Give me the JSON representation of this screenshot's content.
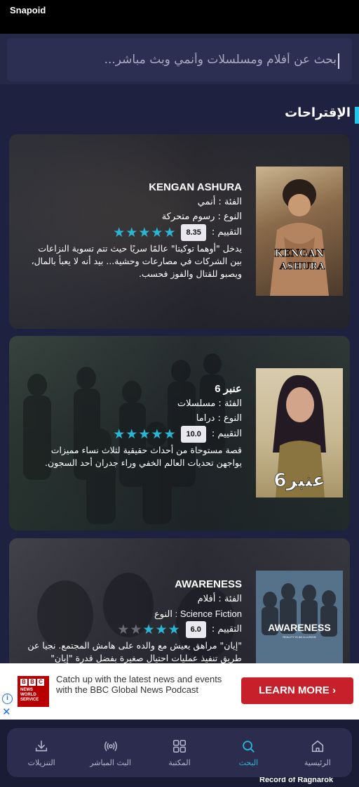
{
  "status_bar": {
    "app_name": "Snapoid"
  },
  "search": {
    "placeholder": "بحث عن أفلام ومسلسلات وأنمي وبث مباشر..."
  },
  "section": {
    "title": "الإقتراحات"
  },
  "cards": [
    {
      "title": "KENGAN ASHURA",
      "category": "الفئة : أنمي",
      "genre": "النوع : رسوم متحركة",
      "rating_label": "التقييم :",
      "rating_value": "8.35",
      "stars_filled": 5,
      "description": "يدخل \"أوهما توكيتا\" عالمًا سريًا حيث تتم تسوية النزاعات بين الشركات في مصارعات وحشية... بيد أنه لا يعبأ بالمال، ويصبو للقتال والفوز فحسب.",
      "poster_text": [
        "KENGAN",
        "ASHURA"
      ],
      "colors": {
        "bg": "#3a3a40",
        "poster": "#6a5a48"
      }
    },
    {
      "title": "عنبر 6",
      "category": "الفئة : مسلسلات",
      "genre": "النوع : دراما",
      "rating_label": "التقييم :",
      "rating_value": "10.0",
      "stars_filled": 5,
      "description": "قصة مستوحاة من أحداث حقيقية لثلاث نساء مميزات يواجهن تحديات العالم الخفي وراء جدران أحد السجون.",
      "poster_text": [
        "عنبر6"
      ],
      "colors": {
        "bg": "#2e3a34",
        "poster": "#c7b892"
      }
    },
    {
      "title": "AWARENESS",
      "category": "الفئة : أفلام",
      "genre": "Science Fiction : النوع",
      "rating_label": "التقييم :",
      "rating_value": "6.0",
      "stars_filled": 3,
      "description": "\"إيان\" مراهق يعيش مع والده على هامش المجتمع. نجيا عن طريق تنفيذ عمليات احتيال صغيرة بفضل قدرة \"إيان\"",
      "poster_text": [
        "AWARENESS",
        "REALITY IS AN ILLUSION"
      ],
      "colors": {
        "bg": "#3c3c44",
        "poster": "#56718a"
      }
    }
  ],
  "ad": {
    "logo_letters": [
      "B",
      "B",
      "C"
    ],
    "logo_text": [
      "NEWS",
      "WORLD",
      "SERVICE"
    ],
    "text": "Catch up with the latest news and events with the BBC Global News Podcast",
    "button_label": "LEARN MORE",
    "button_chevron": "›",
    "info_glyph": "i",
    "close_glyph": "✕"
  },
  "nav": {
    "items": [
      {
        "label": "التنزيلات",
        "icon": "download-icon",
        "active": false
      },
      {
        "label": "البث المباشر",
        "icon": "broadcast-icon",
        "active": false
      },
      {
        "label": "المكتبة",
        "icon": "grid-icon",
        "active": false
      },
      {
        "label": "البحث",
        "icon": "search-icon",
        "active": true
      },
      {
        "label": "الرئيسية",
        "icon": "home-icon",
        "active": false
      }
    ]
  },
  "background_text": "Record of Ragnarok",
  "accent_color": "#2ab6d3"
}
